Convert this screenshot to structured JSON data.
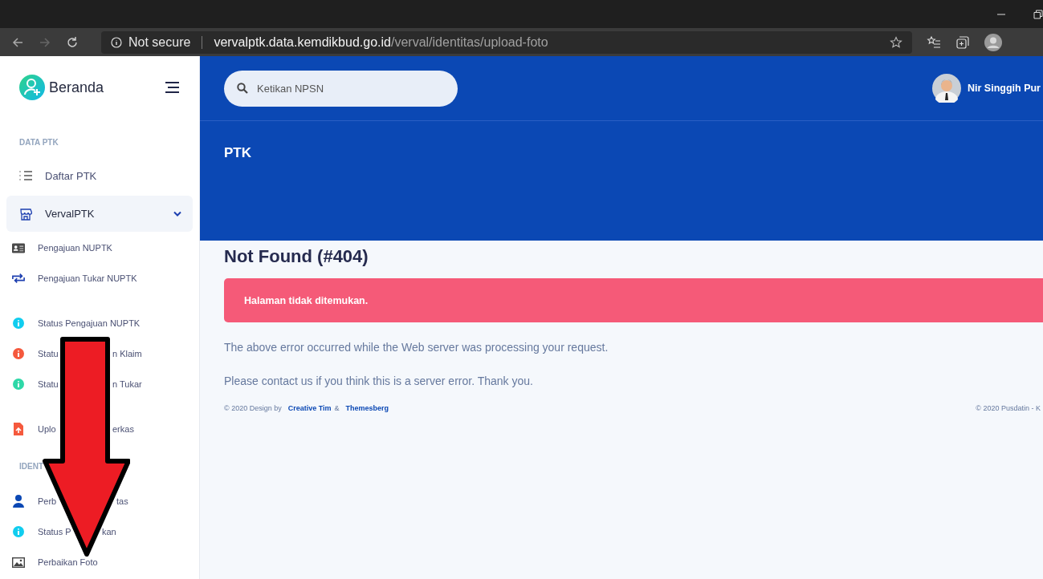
{
  "browser": {
    "security": "Not secure",
    "url_host": "vervalptk.data.kemdikbud.go.id",
    "url_path": "/verval/identitas/upload-foto"
  },
  "sidebar": {
    "brand": "Beranda",
    "items": [
      {
        "kind": "section",
        "label": "DATA PTK"
      },
      {
        "kind": "link",
        "label": "Daftar PTK"
      },
      {
        "kind": "group",
        "label": "VervalPTK",
        "expanded": true
      },
      {
        "kind": "sublink",
        "label": "Pengajuan NUPTK"
      },
      {
        "kind": "sublink",
        "label": "Pengajuan Tukar NUPTK"
      },
      {
        "kind": "gap"
      },
      {
        "kind": "sublink",
        "color": "#11cdef",
        "label": "Status Pengajuan NUPTK"
      },
      {
        "kind": "sublink",
        "color": "#f5593d",
        "label_parts": [
          "Statu",
          "n Klaim"
        ]
      },
      {
        "kind": "sublink",
        "color": "#2ed8a8",
        "label_parts": [
          "Statu",
          "n Tukar"
        ]
      },
      {
        "kind": "gap"
      },
      {
        "kind": "sublink",
        "label_parts": [
          "Uplo",
          "erkas"
        ]
      },
      {
        "kind": "section",
        "label": "IDENT"
      },
      {
        "kind": "sublink",
        "label_parts": [
          "Perb",
          "tas"
        ]
      },
      {
        "kind": "sublink",
        "color": "#11cdef",
        "label_parts": [
          "Status P",
          "kan"
        ]
      },
      {
        "kind": "sublink",
        "label": "Perbaikan Foto"
      }
    ]
  },
  "header": {
    "search": {
      "placeholder": "Ketikan NPSN"
    },
    "user_name": "Nir Singgih Pur",
    "page_title": "PTK"
  },
  "content": {
    "title": "Not Found (#404)",
    "alert": "Halaman tidak ditemukan.",
    "paragraphs": [
      "The above error occurred while the Web server was processing your request.",
      "Please contact us if you think this is a server error. Thank you."
    ]
  },
  "footer": {
    "prefix": "© 2020 Design by",
    "link_1": "Creative Tim",
    "joiner": "&",
    "link_2": "Themesberg",
    "right": "© 2020 Pusdatin - K"
  }
}
